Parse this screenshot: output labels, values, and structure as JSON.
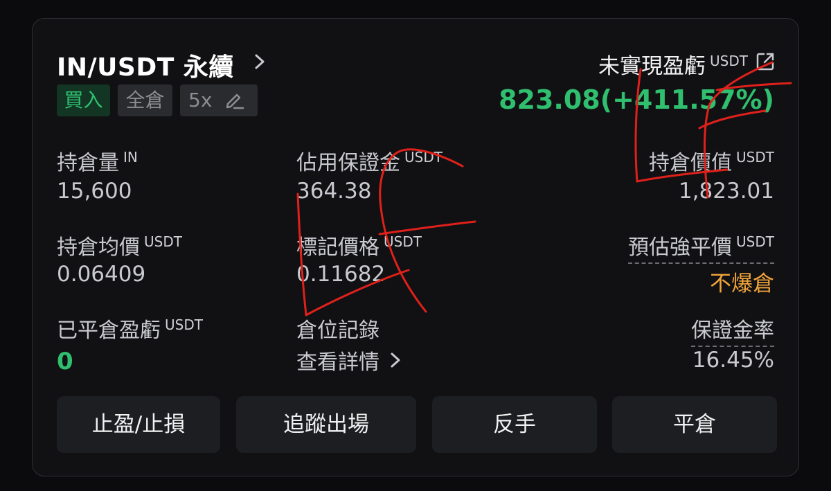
{
  "header": {
    "title": "IN/USDT 永續",
    "tags": {
      "side": "買入",
      "margin_mode": "全倉",
      "leverage": "5x"
    },
    "unrealized_pnl_label": "未實現盈虧",
    "unrealized_pnl_unit": "USDT",
    "unrealized_pnl_value": "823.08(+411.57%)"
  },
  "stats": {
    "position_size": {
      "label": "持倉量",
      "unit": "IN",
      "value": "15,600"
    },
    "margin_used": {
      "label": "佔用保證金",
      "unit": "USDT",
      "value": "364.38"
    },
    "position_value": {
      "label": "持倉價值",
      "unit": "USDT",
      "value": "1,823.01"
    },
    "avg_entry": {
      "label": "持倉均價",
      "unit": "USDT",
      "value": "0.06409"
    },
    "mark_price": {
      "label": "標記價格",
      "unit": "USDT",
      "value": "0.11682"
    },
    "est_liq_price": {
      "label": "預估強平價",
      "unit": "USDT",
      "value": "不爆倉"
    },
    "realized_pnl": {
      "label": "已平倉盈虧",
      "unit": "USDT",
      "value": "0"
    },
    "position_history": {
      "label": "倉位記錄",
      "link": "查看詳情"
    },
    "margin_ratio": {
      "label": "保證金率",
      "value": "16.45%"
    }
  },
  "actions": {
    "tp_sl": "止盈/止損",
    "trailing": "追蹤出場",
    "reverse": "反手",
    "close": "平倉"
  },
  "colors": {
    "profit": "#2fbf6e",
    "warning": "#f0a43a",
    "annotation": "#e0201a",
    "background": "#0b0b0d"
  },
  "icons": [
    "chevron-right-icon",
    "edit-pencil-icon",
    "external-link-icon"
  ]
}
